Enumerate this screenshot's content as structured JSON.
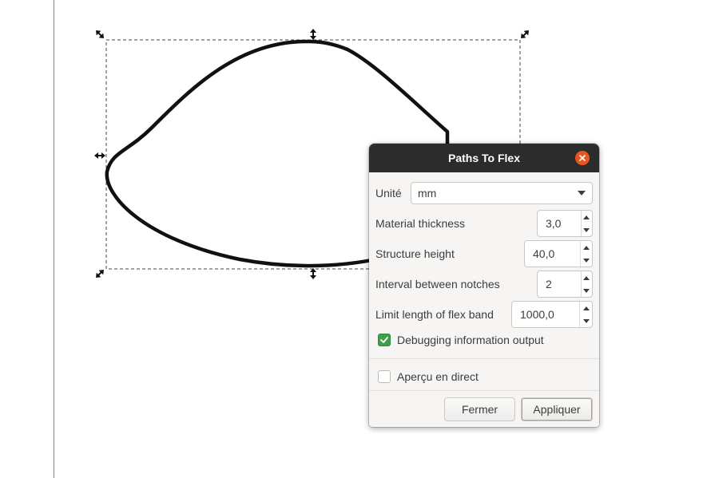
{
  "canvas": {
    "stroke_color": "#111111",
    "selection_handles": [
      "scale-arrow-icon",
      "scale-arrow-icon",
      "scale-arrow-icon",
      "scale-arrow-icon",
      "vertical-arrow-icon",
      "vertical-arrow-icon",
      "horizontal-arrow-icon"
    ]
  },
  "dialog": {
    "title": "Paths To Flex",
    "close_icon": "close-icon",
    "unit": {
      "label": "Unité",
      "value": "mm"
    },
    "material_thickness": {
      "label": "Material thickness",
      "value": "3,0"
    },
    "structure_height": {
      "label": "Structure height",
      "value": "40,0"
    },
    "interval_notches": {
      "label": "Interval between notches",
      "value": "2"
    },
    "limit_length": {
      "label": "Limit length of flex band",
      "value": "1000,0"
    },
    "debug_output": {
      "label": "Debugging information output",
      "checked": true
    },
    "live_preview": {
      "label": "Aperçu en direct",
      "checked": false
    },
    "buttons": {
      "close": "Fermer",
      "apply": "Appliquer"
    },
    "accent_color": "#3e9e4a",
    "close_color": "#e95420"
  }
}
